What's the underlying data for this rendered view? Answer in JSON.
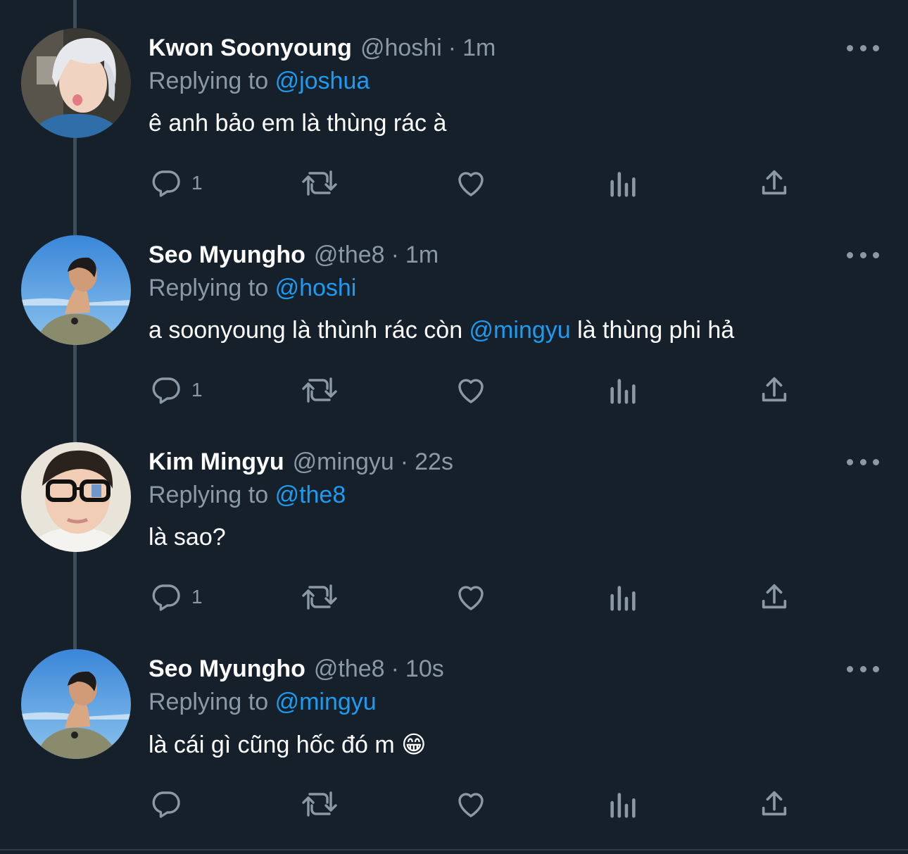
{
  "tweets": [
    {
      "name": "Kwon Soonyoung",
      "handle": "@hoshi",
      "dot": "·",
      "time": "1m",
      "replying_label": "Replying to",
      "replying_to": "@joshua",
      "text_parts": [
        {
          "text": "ê anh bảo em là thùng rác à",
          "mention": false
        }
      ],
      "reply_count": "1",
      "avatar": "silver-hair-avatar"
    },
    {
      "name": "Seo Myungho",
      "handle": "@the8",
      "dot": "·",
      "time": "1m",
      "replying_label": "Replying to",
      "replying_to": "@hoshi",
      "text_parts": [
        {
          "text": "a soonyoung là thùnh rác còn ",
          "mention": false
        },
        {
          "text": "@mingyu",
          "mention": true
        },
        {
          "text": " là thùng phi hả",
          "mention": false
        }
      ],
      "reply_count": "1",
      "avatar": "sky-avatar"
    },
    {
      "name": "Kim Mingyu",
      "handle": "@mingyu",
      "dot": "·",
      "time": "22s",
      "replying_label": "Replying to",
      "replying_to": "@the8",
      "text_parts": [
        {
          "text": "là sao?",
          "mention": false
        }
      ],
      "reply_count": "1",
      "avatar": "glasses-avatar"
    },
    {
      "name": "Seo Myungho",
      "handle": "@the8",
      "dot": "·",
      "time": "10s",
      "replying_label": "Replying to",
      "replying_to": "@mingyu",
      "text_parts": [
        {
          "text": "là cái gì cũng hốc đó m ",
          "mention": false
        },
        {
          "text": "😁",
          "mention": false
        }
      ],
      "reply_count": "",
      "avatar": "sky-avatar"
    }
  ],
  "colors": {
    "background": "#15202b",
    "text_primary": "#ffffff",
    "text_secondary": "#8b98a5",
    "mention": "#1d9bf0",
    "thread_line": "#3d4d5c"
  },
  "icons": {
    "reply": "reply-icon",
    "retweet": "retweet-icon",
    "like": "heart-icon",
    "views": "views-chart-icon",
    "share": "share-icon",
    "more": "more-dots-icon"
  }
}
